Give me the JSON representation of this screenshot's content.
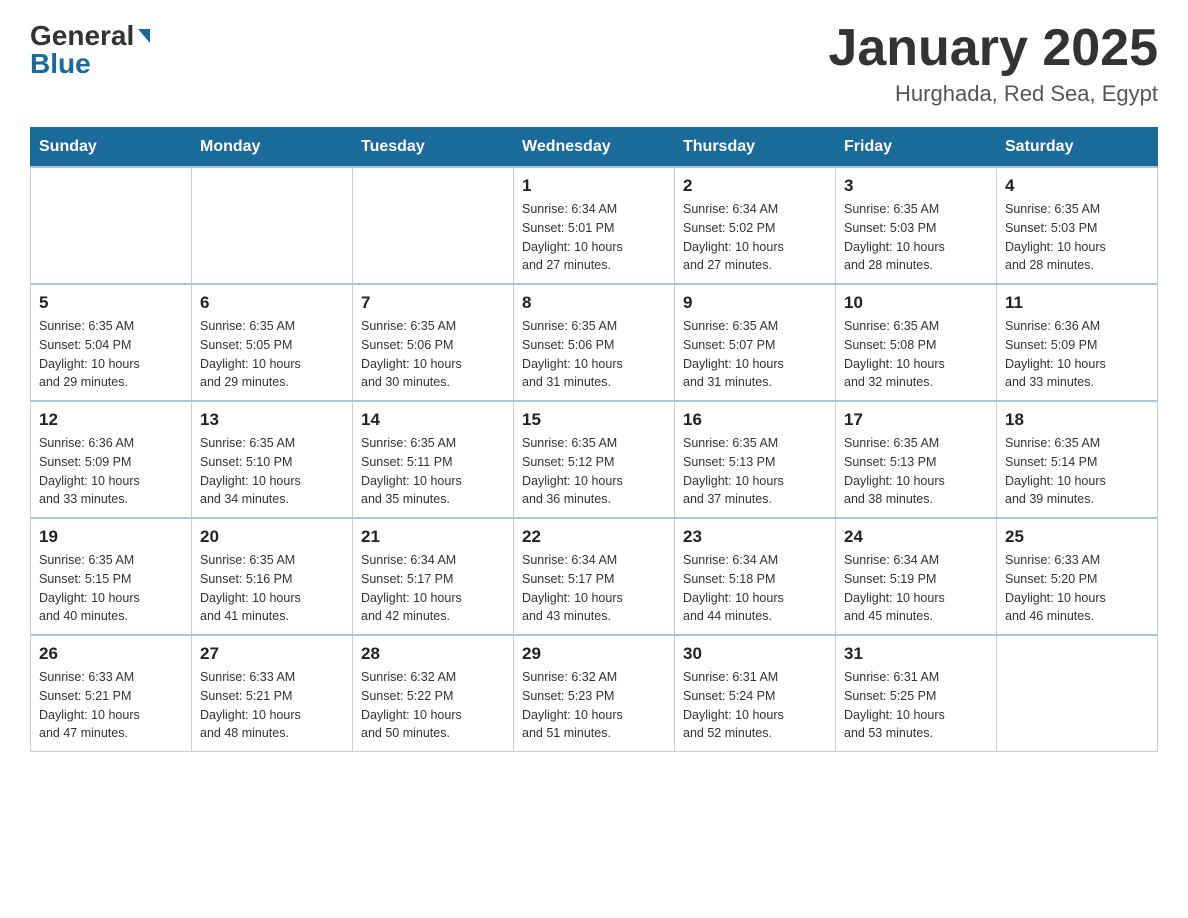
{
  "header": {
    "logo_general": "General",
    "logo_blue": "Blue",
    "title": "January 2025",
    "location": "Hurghada, Red Sea, Egypt"
  },
  "days_of_week": [
    "Sunday",
    "Monday",
    "Tuesday",
    "Wednesday",
    "Thursday",
    "Friday",
    "Saturday"
  ],
  "weeks": [
    [
      {
        "num": "",
        "info": ""
      },
      {
        "num": "",
        "info": ""
      },
      {
        "num": "",
        "info": ""
      },
      {
        "num": "1",
        "info": "Sunrise: 6:34 AM\nSunset: 5:01 PM\nDaylight: 10 hours\nand 27 minutes."
      },
      {
        "num": "2",
        "info": "Sunrise: 6:34 AM\nSunset: 5:02 PM\nDaylight: 10 hours\nand 27 minutes."
      },
      {
        "num": "3",
        "info": "Sunrise: 6:35 AM\nSunset: 5:03 PM\nDaylight: 10 hours\nand 28 minutes."
      },
      {
        "num": "4",
        "info": "Sunrise: 6:35 AM\nSunset: 5:03 PM\nDaylight: 10 hours\nand 28 minutes."
      }
    ],
    [
      {
        "num": "5",
        "info": "Sunrise: 6:35 AM\nSunset: 5:04 PM\nDaylight: 10 hours\nand 29 minutes."
      },
      {
        "num": "6",
        "info": "Sunrise: 6:35 AM\nSunset: 5:05 PM\nDaylight: 10 hours\nand 29 minutes."
      },
      {
        "num": "7",
        "info": "Sunrise: 6:35 AM\nSunset: 5:06 PM\nDaylight: 10 hours\nand 30 minutes."
      },
      {
        "num": "8",
        "info": "Sunrise: 6:35 AM\nSunset: 5:06 PM\nDaylight: 10 hours\nand 31 minutes."
      },
      {
        "num": "9",
        "info": "Sunrise: 6:35 AM\nSunset: 5:07 PM\nDaylight: 10 hours\nand 31 minutes."
      },
      {
        "num": "10",
        "info": "Sunrise: 6:35 AM\nSunset: 5:08 PM\nDaylight: 10 hours\nand 32 minutes."
      },
      {
        "num": "11",
        "info": "Sunrise: 6:36 AM\nSunset: 5:09 PM\nDaylight: 10 hours\nand 33 minutes."
      }
    ],
    [
      {
        "num": "12",
        "info": "Sunrise: 6:36 AM\nSunset: 5:09 PM\nDaylight: 10 hours\nand 33 minutes."
      },
      {
        "num": "13",
        "info": "Sunrise: 6:35 AM\nSunset: 5:10 PM\nDaylight: 10 hours\nand 34 minutes."
      },
      {
        "num": "14",
        "info": "Sunrise: 6:35 AM\nSunset: 5:11 PM\nDaylight: 10 hours\nand 35 minutes."
      },
      {
        "num": "15",
        "info": "Sunrise: 6:35 AM\nSunset: 5:12 PM\nDaylight: 10 hours\nand 36 minutes."
      },
      {
        "num": "16",
        "info": "Sunrise: 6:35 AM\nSunset: 5:13 PM\nDaylight: 10 hours\nand 37 minutes."
      },
      {
        "num": "17",
        "info": "Sunrise: 6:35 AM\nSunset: 5:13 PM\nDaylight: 10 hours\nand 38 minutes."
      },
      {
        "num": "18",
        "info": "Sunrise: 6:35 AM\nSunset: 5:14 PM\nDaylight: 10 hours\nand 39 minutes."
      }
    ],
    [
      {
        "num": "19",
        "info": "Sunrise: 6:35 AM\nSunset: 5:15 PM\nDaylight: 10 hours\nand 40 minutes."
      },
      {
        "num": "20",
        "info": "Sunrise: 6:35 AM\nSunset: 5:16 PM\nDaylight: 10 hours\nand 41 minutes."
      },
      {
        "num": "21",
        "info": "Sunrise: 6:34 AM\nSunset: 5:17 PM\nDaylight: 10 hours\nand 42 minutes."
      },
      {
        "num": "22",
        "info": "Sunrise: 6:34 AM\nSunset: 5:17 PM\nDaylight: 10 hours\nand 43 minutes."
      },
      {
        "num": "23",
        "info": "Sunrise: 6:34 AM\nSunset: 5:18 PM\nDaylight: 10 hours\nand 44 minutes."
      },
      {
        "num": "24",
        "info": "Sunrise: 6:34 AM\nSunset: 5:19 PM\nDaylight: 10 hours\nand 45 minutes."
      },
      {
        "num": "25",
        "info": "Sunrise: 6:33 AM\nSunset: 5:20 PM\nDaylight: 10 hours\nand 46 minutes."
      }
    ],
    [
      {
        "num": "26",
        "info": "Sunrise: 6:33 AM\nSunset: 5:21 PM\nDaylight: 10 hours\nand 47 minutes."
      },
      {
        "num": "27",
        "info": "Sunrise: 6:33 AM\nSunset: 5:21 PM\nDaylight: 10 hours\nand 48 minutes."
      },
      {
        "num": "28",
        "info": "Sunrise: 6:32 AM\nSunset: 5:22 PM\nDaylight: 10 hours\nand 50 minutes."
      },
      {
        "num": "29",
        "info": "Sunrise: 6:32 AM\nSunset: 5:23 PM\nDaylight: 10 hours\nand 51 minutes."
      },
      {
        "num": "30",
        "info": "Sunrise: 6:31 AM\nSunset: 5:24 PM\nDaylight: 10 hours\nand 52 minutes."
      },
      {
        "num": "31",
        "info": "Sunrise: 6:31 AM\nSunset: 5:25 PM\nDaylight: 10 hours\nand 53 minutes."
      },
      {
        "num": "",
        "info": ""
      }
    ]
  ]
}
